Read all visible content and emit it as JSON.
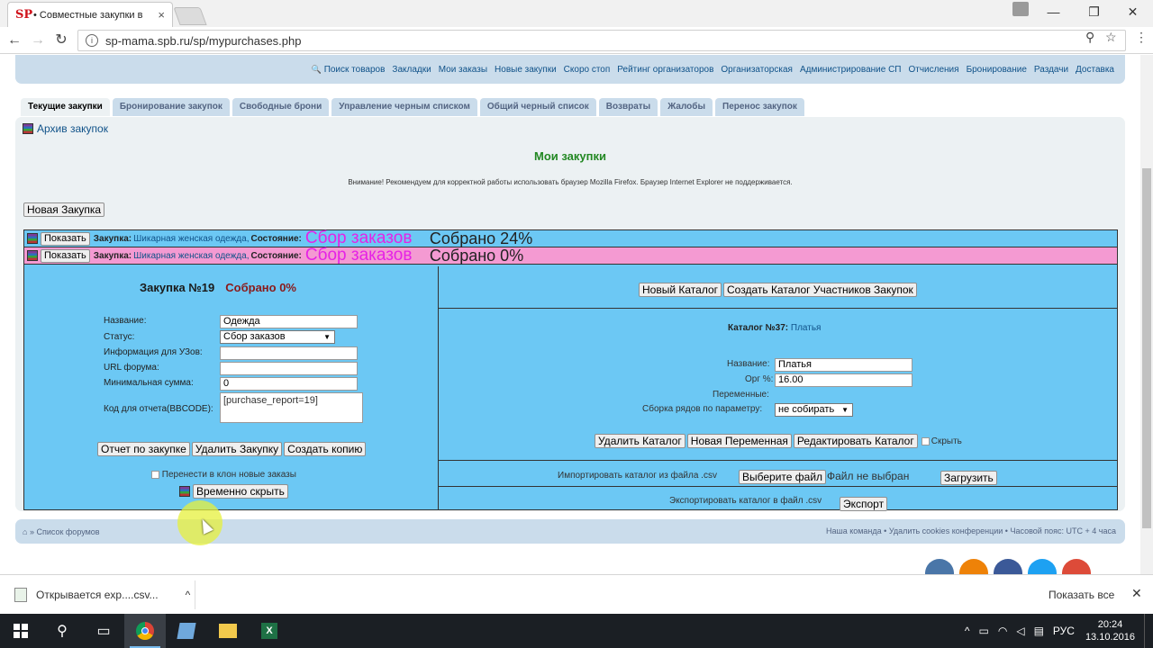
{
  "browser": {
    "favicon": "SP",
    "tab_title": "• Совместные закупки в",
    "tab_close": "×",
    "url": "sp-mama.spb.ru/sp/mypurchases.php",
    "back_icon": "←",
    "forward_icon": "→",
    "reload_icon": "↻",
    "info_icon": "i",
    "zoom_icon": "⚲",
    "star_icon": "☆",
    "menu_icon": "⋮",
    "minimize": "—",
    "maximize": "❐",
    "close": "✕"
  },
  "topnav": {
    "search_icon": "🔍",
    "links": [
      "Поиск товаров",
      "Закладки",
      "Мои заказы",
      "Новые закупки",
      "Скоро стоп",
      "Рейтинг организаторов",
      "Организаторская",
      "Администрирование СП",
      "Отчисления",
      "Бронирование",
      "Раздачи",
      "Доставка"
    ]
  },
  "tabs": [
    "Текущие закупки",
    "Бронирование закупок",
    "Свободные брони",
    "Управление черным списком",
    "Общий черный список",
    "Возвраты",
    "Жалобы",
    "Перенос закупок"
  ],
  "archive_label": "Архив закупок",
  "page_title": "Мои закупки",
  "warning": "Внимание! Рекомендуем для корректной работы использовать браузер Mozilla Firefox. Браузер Internet Explorer не поддерживается.",
  "new_purchase_button": "Новая Закупка",
  "purchase_rows": [
    {
      "button": "Показать",
      "label": "Закупка:",
      "name": "Шикарная женская одежда,",
      "state_label": "Состояние:",
      "status": "Сбор заказов",
      "collected": "Собрано 24%",
      "color": "#6cc8f4"
    },
    {
      "button": "Показать",
      "label": "Закупка:",
      "name": "Шикарная женская одежда,",
      "state_label": "Состояние:",
      "status": "Сбор заказов",
      "collected": "Собрано 0%",
      "color": "#f49ad2"
    }
  ],
  "purchase": {
    "title": "Закупка №19",
    "collected": "Собрано 0%",
    "fields": {
      "name_label": "Название:",
      "name_value": "Одежда",
      "status_label": "Статус:",
      "status_value": "Сбор заказов",
      "info_label": "Информация для УЗов:",
      "info_value": "",
      "url_label": "URL форума:",
      "url_value": "",
      "min_label": "Минимальная сумма:",
      "min_value": "0",
      "code_label": "Код для отчета(BBCODE):",
      "code_value": "[purchase_report=19]"
    },
    "buttons": [
      "Отчет по закупке",
      "Удалить Закупку",
      "Создать копию"
    ],
    "transfer_label": "Перенести в клон новые заказы",
    "hide_button": "Временно скрыть"
  },
  "catalog": {
    "new_catalog_button": "Новый Каталог",
    "create_participants_button": "Создать Каталог Участников Закупок",
    "title_label": "Каталог №37:",
    "title_name": "Платья",
    "name_label": "Название:",
    "name_value": "Платья",
    "org_label": "Орг %:",
    "org_value": "16.00",
    "variables_label": "Переменные:",
    "rows_label": "Сборка рядов по параметру:",
    "rows_value": "не собирать",
    "buttons": [
      "Удалить Каталог",
      "Новая Переменная",
      "Редактировать Каталог"
    ],
    "hide_label": "Скрыть",
    "import_label": "Импортировать каталог из файла .csv",
    "choose_file_button": "Выберите файл",
    "no_file": "Файл не выбран",
    "upload_button": "Загрузить",
    "export_label": "Экспортировать каталог в файл .csv",
    "export_button": "Экспорт"
  },
  "footer": {
    "left": "» Список форумов",
    "right": "Наша команда • Удалить cookies конференции • Часовой пояс: UTC + 4 часа"
  },
  "social_colors": [
    "#4a76a8",
    "#ee8208",
    "#3b5998",
    "#1da1f2",
    "#dd4b39"
  ],
  "download": {
    "item": "Открывается exp....csv...",
    "arrow": "^",
    "show_all": "Показать все",
    "close": "✕"
  },
  "taskbar": {
    "lang": "РУС",
    "time": "20:24",
    "date": "13.10.2016"
  }
}
